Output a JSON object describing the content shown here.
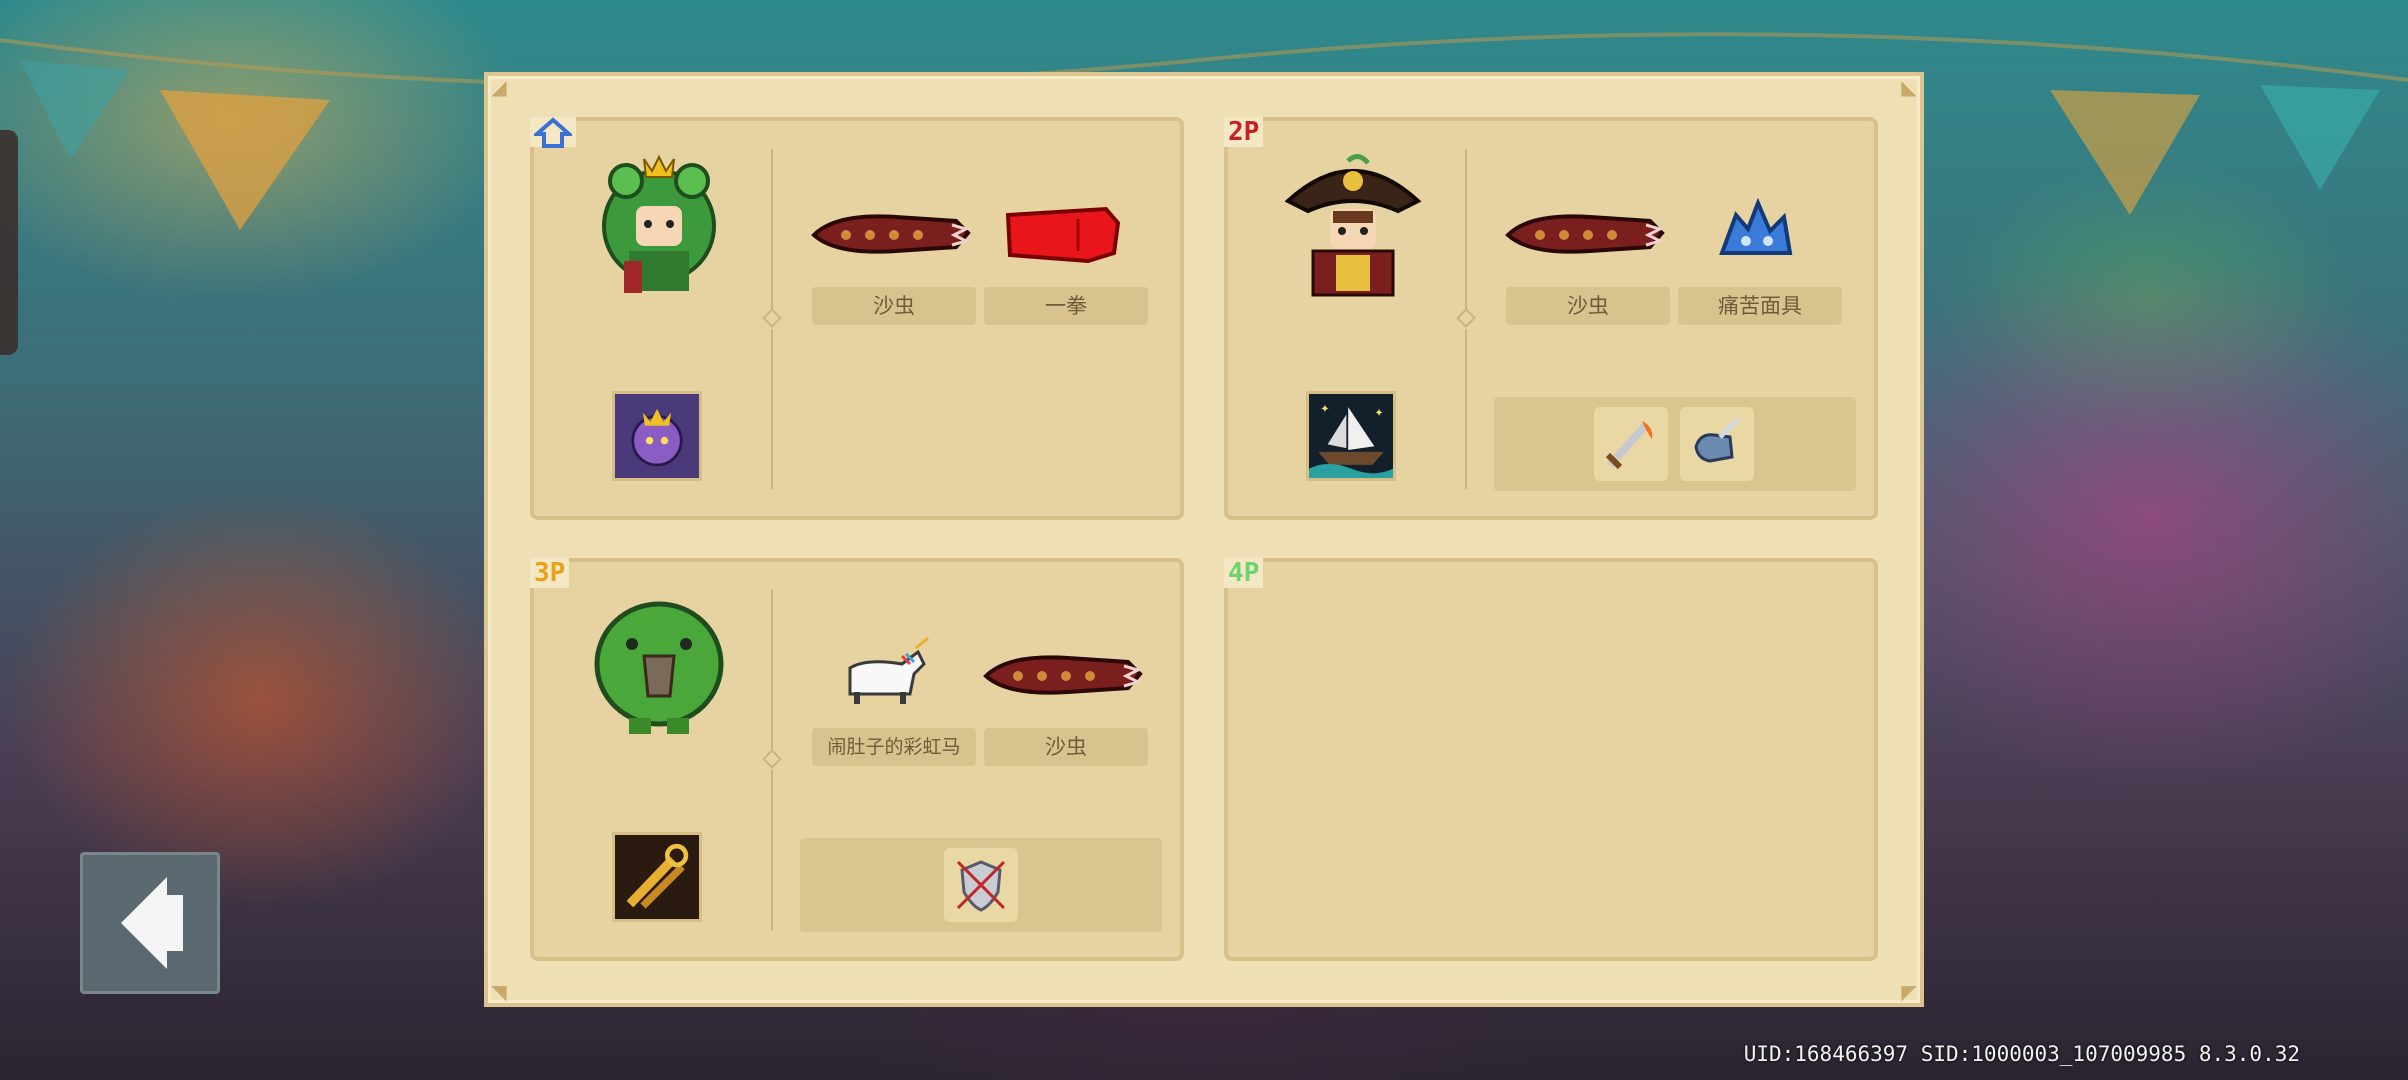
{
  "colors": {
    "panel_bg": "#efdfb4",
    "card_bg": "#e6d3a1",
    "label_bg": "#d8c38f",
    "p1": "#3a6fd8",
    "p2": "#c62020",
    "p3": "#e8a21a",
    "p4": "#6fd36f"
  },
  "players": [
    {
      "badge": "",
      "badge_icon": "home-icon",
      "character": "frog-hood-knight",
      "pet": "purple-crowned-pet",
      "weapons": [
        {
          "icon": "sandworm-weapon-icon",
          "label": "沙虫"
        },
        {
          "icon": "red-fist-weapon-icon",
          "label": "一拳"
        }
      ],
      "buffs": []
    },
    {
      "badge": "2P",
      "character": "pirate-captain",
      "pet": "ghost-ship-pet",
      "weapons": [
        {
          "icon": "sandworm-weapon-icon",
          "label": "沙虫"
        },
        {
          "icon": "blue-crystal-mask-icon",
          "label": "痛苦面具"
        }
      ],
      "buffs": [
        "flame-sword-buff-icon",
        "blade-gauntlet-buff-icon"
      ]
    },
    {
      "badge": "3P",
      "character": "green-dino-blob",
      "pet": "golden-keys-pet",
      "weapons": [
        {
          "icon": "rainbow-unicorn-icon",
          "label": "闹肚子的彩虹马"
        },
        {
          "icon": "sandworm-weapon-icon",
          "label": "沙虫"
        }
      ],
      "buffs": [
        "shield-crest-buff-icon"
      ]
    },
    {
      "badge": "4P",
      "empty": true
    }
  ],
  "footer": {
    "text": "UID:168466397 SID:1000003_107009985 8.3.0.32"
  },
  "back_button": {
    "icon": "back-arrow-icon"
  }
}
